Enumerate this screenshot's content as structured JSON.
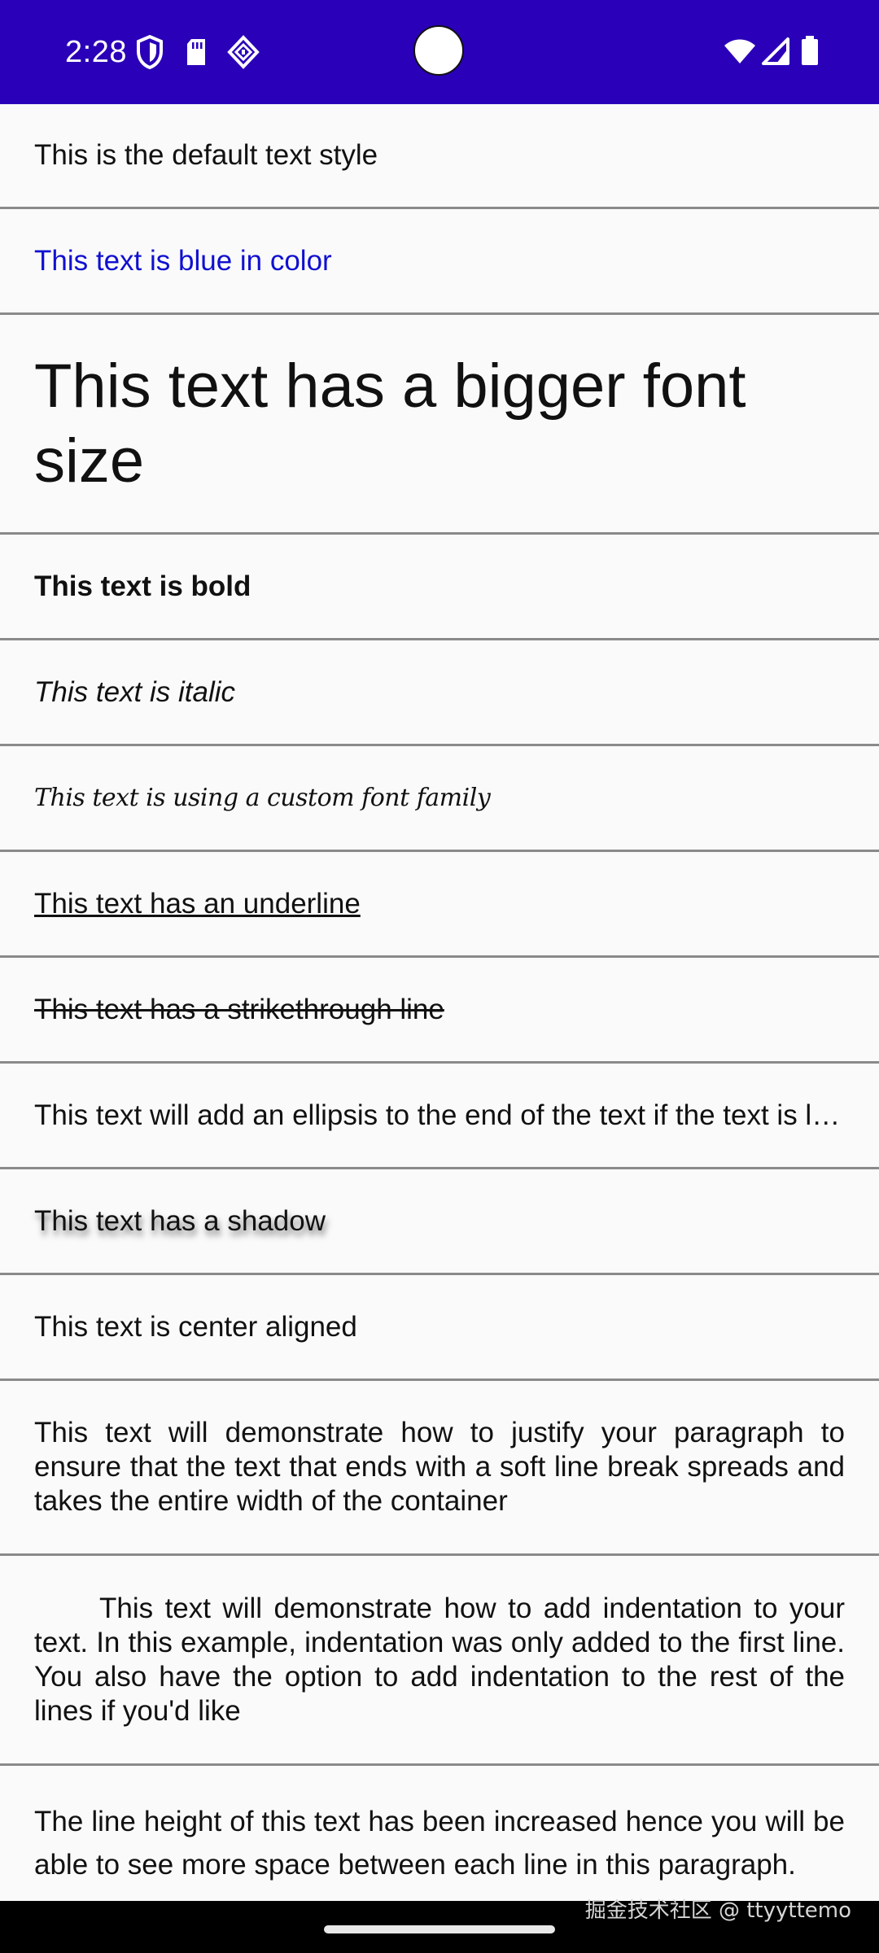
{
  "status_bar": {
    "time": "2:28",
    "color": "#2a00b8",
    "left_icons": [
      "shield-icon",
      "sd-card-icon",
      "diamond-icon"
    ],
    "right_icons": [
      "wifi-icon",
      "signal-icon",
      "battery-icon"
    ]
  },
  "rows": [
    "This is the default text style",
    "This text is blue in color",
    "This text has a bigger font size",
    "This text is bold",
    "This text is italic",
    "This text is using a custom font family",
    "This text has an underline",
    "This text has a strikethrough line",
    "This text will add an ellipsis to the end of the text if the text is longer than the available width",
    "This text has a shadow",
    "This text is center aligned",
    "This text will demonstrate how to justify your paragraph to ensure that the text that ends with a soft line break spreads and takes the entire width of the container",
    "This text will demonstrate how to add indentation to your text. In this example, indentation was only added to the first line. You also have the option to add indentation to the rest of the lines if you'd like",
    "The line height of this text has been increased hence you will be able to see more space between each line in this paragraph."
  ],
  "colors": {
    "blue_text": "#1010d0",
    "divider": "#8a8a8a"
  },
  "watermark": "掘金技术社区 @ ttyyttemo"
}
